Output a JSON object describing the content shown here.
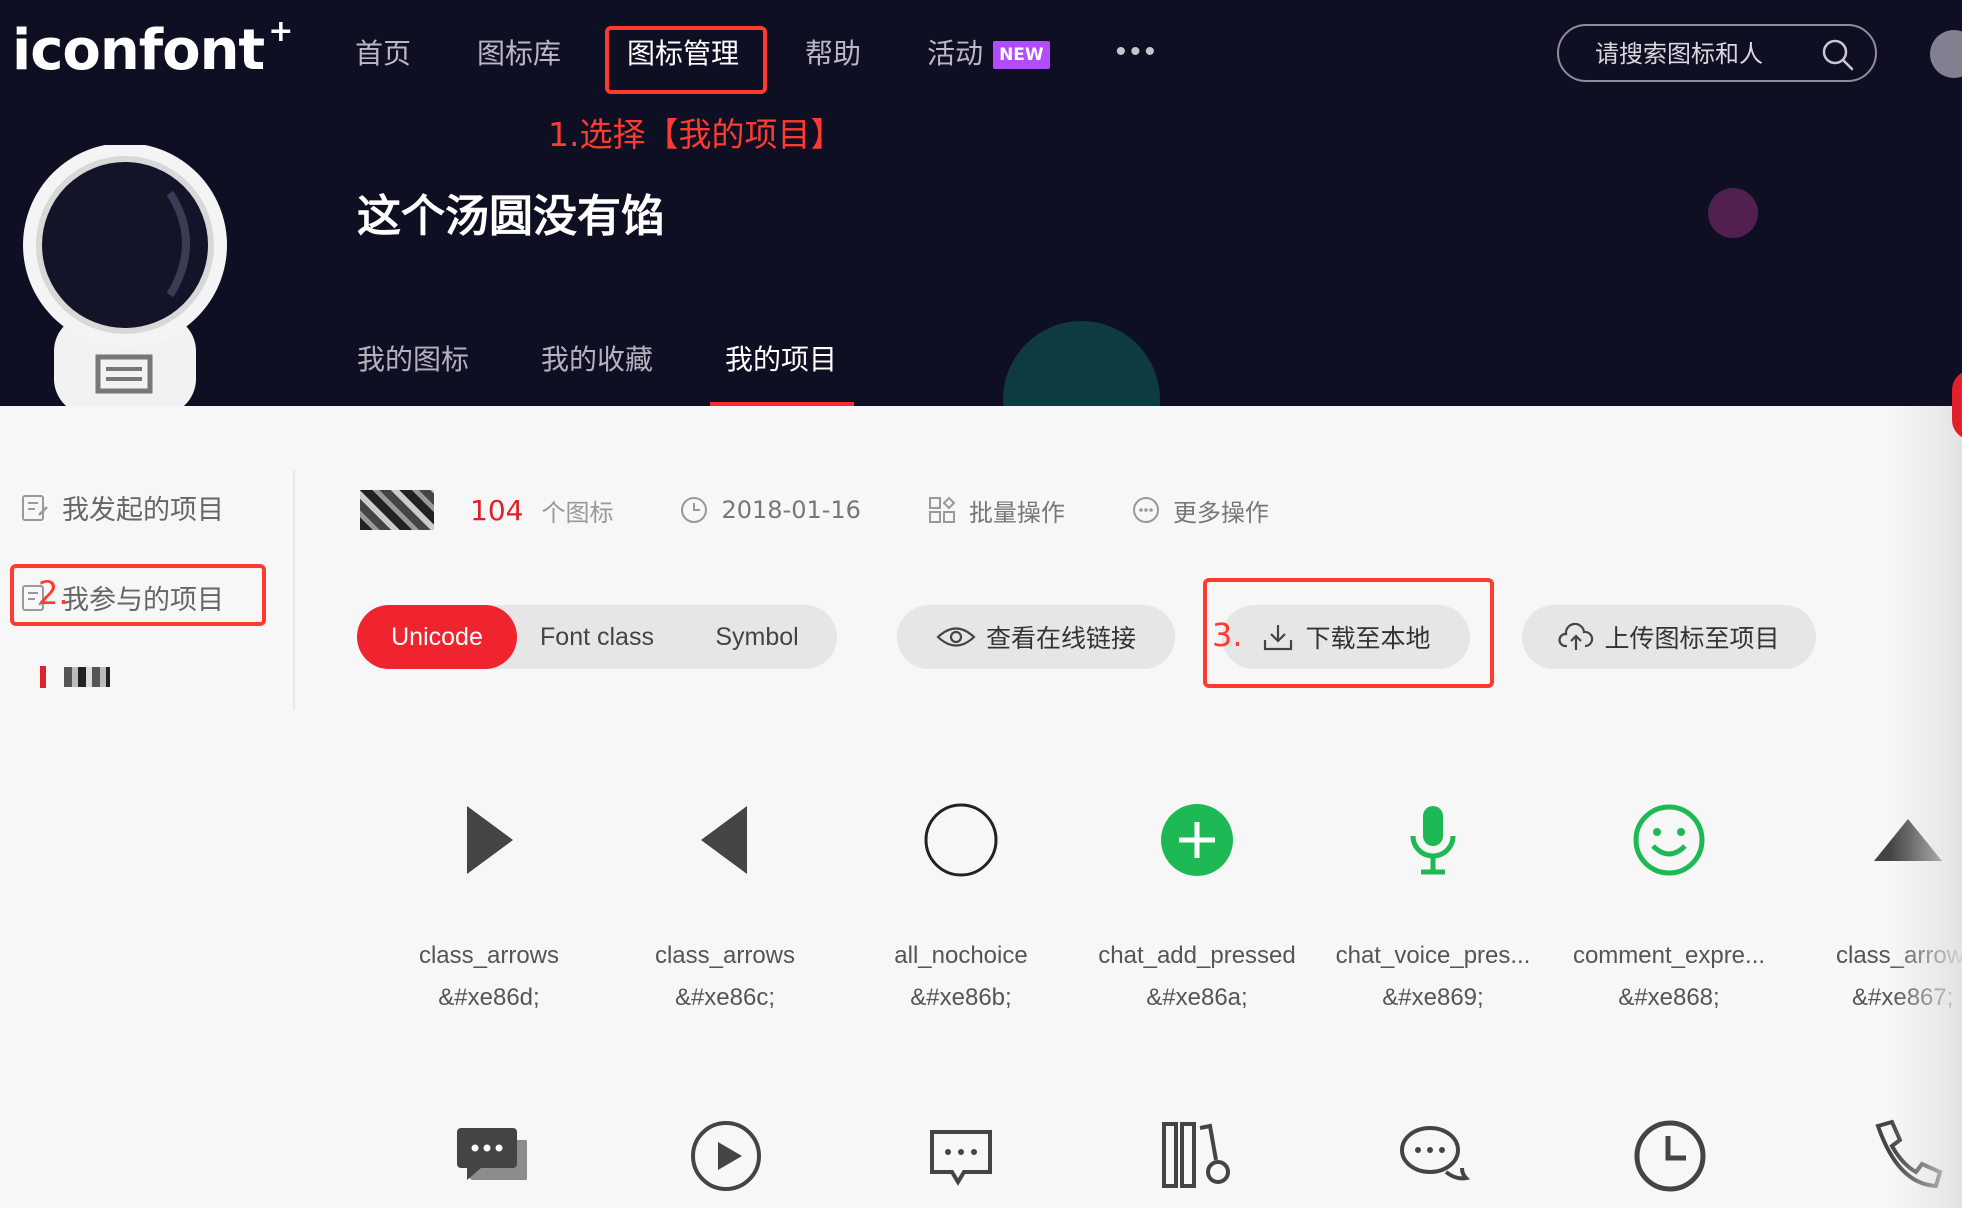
{
  "logo": {
    "text": "iconfont",
    "plus": "+"
  },
  "nav": {
    "items": [
      "首页",
      "图标库",
      "图标管理",
      "帮助",
      "活动"
    ],
    "new_badge": "NEW",
    "more": "•••"
  },
  "search": {
    "placeholder": "请搜索图标和人"
  },
  "annotations": {
    "step1": "1.选择【我的项目】",
    "step2": "2.",
    "step3": "3."
  },
  "profile": {
    "name": "这个汤圆没有馅"
  },
  "subtabs": [
    "我的图标",
    "我的收藏",
    "我的项目"
  ],
  "sidebar": {
    "items": [
      "我发起的项目",
      "我参与的项目"
    ]
  },
  "project": {
    "count": "104",
    "count_unit": "个图标",
    "date": "2018-01-16",
    "batch": "批量操作",
    "more": "更多操作"
  },
  "segment": {
    "options": [
      "Unicode",
      "Font class",
      "Symbol"
    ],
    "active": "Unicode"
  },
  "actions": {
    "view_link": "查看在线链接",
    "download": "下载至本地",
    "upload": "上传图标至项目"
  },
  "icons": [
    {
      "name": "class_arrows",
      "code": "&#xe86d;",
      "icon": "play-triangle-icon"
    },
    {
      "name": "class_arrows",
      "code": "&#xe86c;",
      "icon": "back-triangle-icon"
    },
    {
      "name": "all_nochoice",
      "code": "&#xe86b;",
      "icon": "circle-outline-icon"
    },
    {
      "name": "chat_add_pressed",
      "code": "&#xe86a;",
      "icon": "green-plus-icon"
    },
    {
      "name": "chat_voice_pres...",
      "code": "&#xe869;",
      "icon": "microphone-icon"
    },
    {
      "name": "comment_expre...",
      "code": "&#xe868;",
      "icon": "smiley-icon"
    },
    {
      "name": "class_arrow",
      "code": "&#xe867;",
      "icon": "up-triangle-icon"
    }
  ],
  "colors": {
    "hero_bg": "#0f0f24",
    "accent_red": "#f0242f",
    "annotation": "#ff3b2f",
    "green": "#1db954"
  }
}
